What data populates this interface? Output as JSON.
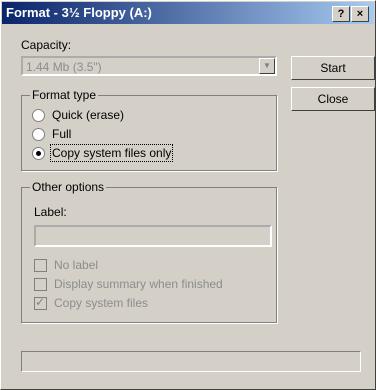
{
  "window": {
    "title": "Format - 3½ Floppy (A:)",
    "help_label": "?",
    "close_label": "×"
  },
  "capacity": {
    "label": "Capacity:",
    "value": "1.44 Mb (3.5\")"
  },
  "buttons": {
    "start": "Start",
    "close": "Close"
  },
  "format_type": {
    "legend": "Format type",
    "options": [
      {
        "label": "Quick (erase)",
        "selected": false
      },
      {
        "label": "Full",
        "selected": false
      },
      {
        "label": "Copy system files only",
        "selected": true
      }
    ]
  },
  "other_options": {
    "legend": "Other options",
    "label_field": {
      "label": "Label:",
      "value": ""
    },
    "checkboxes": [
      {
        "label": "No label",
        "checked": false
      },
      {
        "label": "Display summary when finished",
        "checked": false
      },
      {
        "label": "Copy system files",
        "checked": true
      }
    ]
  }
}
